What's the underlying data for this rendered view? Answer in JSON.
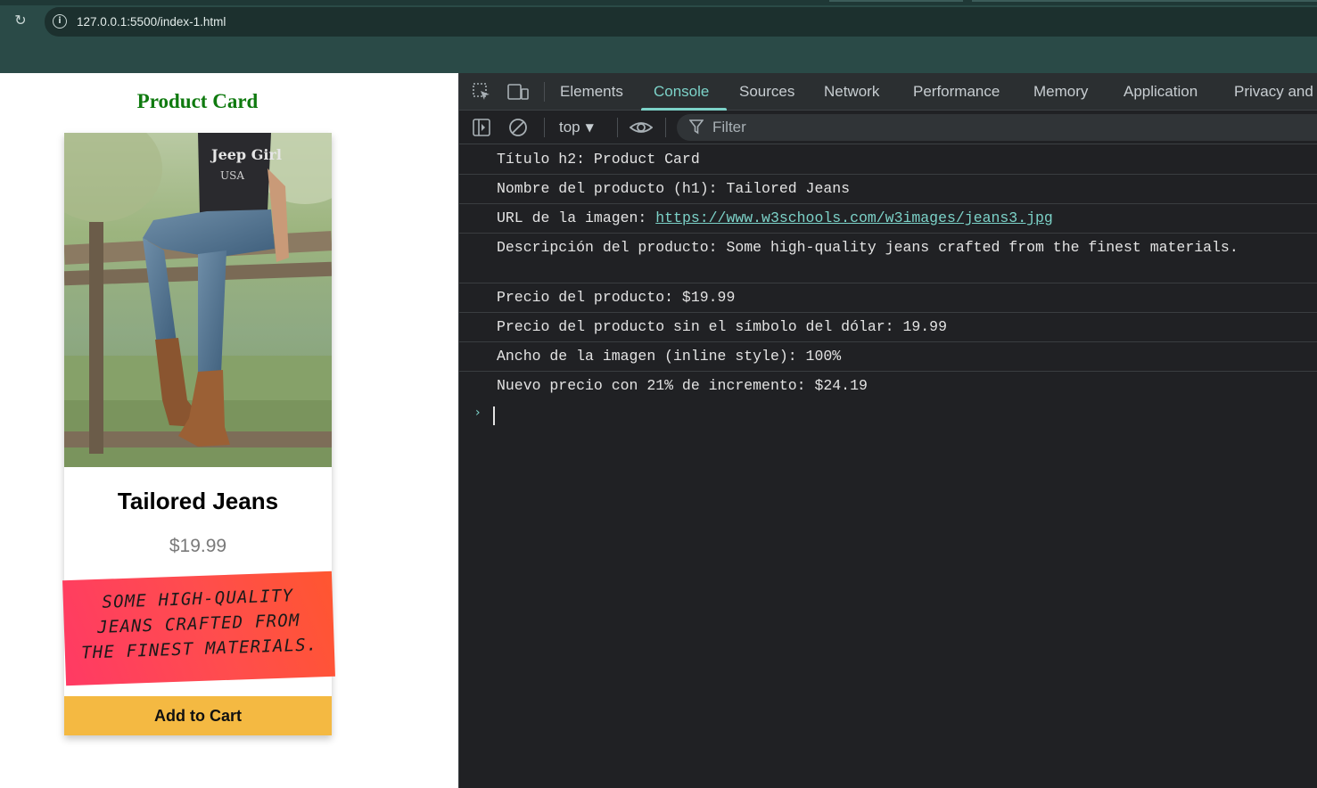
{
  "browser": {
    "url": "127.0.0.1:5500/index-1.html"
  },
  "page": {
    "title": "Product Card",
    "product": {
      "name": "Tailored Jeans",
      "price": "$19.99",
      "description": "Some high-quality jeans crafted from the finest materials.",
      "button_label": "Add to Cart"
    }
  },
  "devtools": {
    "tabs": [
      "Elements",
      "Console",
      "Sources",
      "Network",
      "Performance",
      "Memory",
      "Application",
      "Privacy and"
    ],
    "active_tab": "Console",
    "toolbar": {
      "context": "top",
      "filter_placeholder": "Filter"
    },
    "console": {
      "logs": [
        "Título h2: Product Card",
        "Nombre del producto (h1): Tailored Jeans",
        "URL de la imagen: ",
        "Descripción del producto: Some high-quality jeans crafted from the finest materials.",
        "Precio del producto: $19.99",
        "Precio del producto sin el símbolo del dólar: 19.99",
        "Ancho de la imagen (inline style): 100%",
        "Nuevo precio con 21% de incremento: $24.19"
      ],
      "image_url": "https://www.w3schools.com/w3images/jeans3.jpg"
    }
  },
  "colors": {
    "page_title": "#0f7a0f",
    "description_gradient_start": "#ff3a64",
    "description_gradient_end": "#ff5630",
    "button": "#f4b942",
    "devtools_accent": "#7cd2c8",
    "chrome": "#2a4a47"
  },
  "icons": [
    "reload-icon",
    "site-info-icon",
    "inspect-element-icon",
    "device-toolbar-icon",
    "sidebar-toggle-icon",
    "clear-console-icon",
    "live-expression-icon",
    "filter-icon"
  ]
}
